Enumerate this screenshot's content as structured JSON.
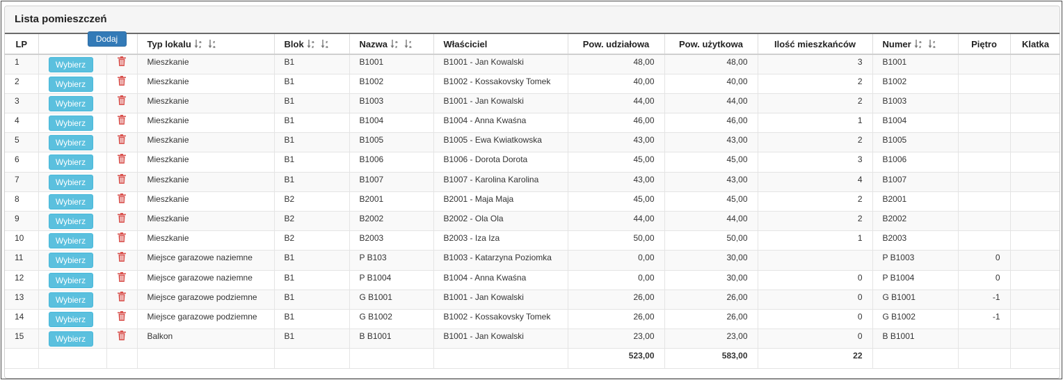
{
  "panel": {
    "title": "Lista pomieszczeń"
  },
  "header": {
    "lp": "LP",
    "dodaj": "Dodaj",
    "typ": "Typ lokalu",
    "blok": "Blok",
    "nazwa": "Nazwa",
    "wlasciciel": "Właściciel",
    "pow_udz": "Pow. udziałowa",
    "pow_uz": "Pow. użytkowa",
    "ilosc": "Ilość mieszkańców",
    "numer": "Numer",
    "pietro": "Piętro",
    "klatka": "Klatka"
  },
  "row_button_label": "Wybierz",
  "rows": [
    {
      "lp": "1",
      "typ": "Mieszkanie",
      "blok": "B1",
      "nazwa": "B1001",
      "wlasciciel": "B1001 - Jan Kowalski",
      "pow_udz": "48,00",
      "pow_uz": "48,00",
      "ilosc": "3",
      "numer": "B1001",
      "pietro": "",
      "klatka": ""
    },
    {
      "lp": "2",
      "typ": "Mieszkanie",
      "blok": "B1",
      "nazwa": "B1002",
      "wlasciciel": "B1002 - Kossakovsky Tomek",
      "pow_udz": "40,00",
      "pow_uz": "40,00",
      "ilosc": "2",
      "numer": "B1002",
      "pietro": "",
      "klatka": ""
    },
    {
      "lp": "3",
      "typ": "Mieszkanie",
      "blok": "B1",
      "nazwa": "B1003",
      "wlasciciel": "B1001 - Jan Kowalski",
      "pow_udz": "44,00",
      "pow_uz": "44,00",
      "ilosc": "2",
      "numer": "B1003",
      "pietro": "",
      "klatka": ""
    },
    {
      "lp": "4",
      "typ": "Mieszkanie",
      "blok": "B1",
      "nazwa": "B1004",
      "wlasciciel": "B1004 - Anna Kwaśna",
      "pow_udz": "46,00",
      "pow_uz": "46,00",
      "ilosc": "1",
      "numer": "B1004",
      "pietro": "",
      "klatka": ""
    },
    {
      "lp": "5",
      "typ": "Mieszkanie",
      "blok": "B1",
      "nazwa": "B1005",
      "wlasciciel": "B1005 - Ewa Kwiatkowska",
      "pow_udz": "43,00",
      "pow_uz": "43,00",
      "ilosc": "2",
      "numer": "B1005",
      "pietro": "",
      "klatka": ""
    },
    {
      "lp": "6",
      "typ": "Mieszkanie",
      "blok": "B1",
      "nazwa": "B1006",
      "wlasciciel": "B1006 - Dorota Dorota",
      "pow_udz": "45,00",
      "pow_uz": "45,00",
      "ilosc": "3",
      "numer": "B1006",
      "pietro": "",
      "klatka": ""
    },
    {
      "lp": "7",
      "typ": "Mieszkanie",
      "blok": "B1",
      "nazwa": "B1007",
      "wlasciciel": "B1007 - Karolina Karolina",
      "pow_udz": "43,00",
      "pow_uz": "43,00",
      "ilosc": "4",
      "numer": "B1007",
      "pietro": "",
      "klatka": ""
    },
    {
      "lp": "8",
      "typ": "Mieszkanie",
      "blok": "B2",
      "nazwa": "B2001",
      "wlasciciel": "B2001 - Maja Maja",
      "pow_udz": "45,00",
      "pow_uz": "45,00",
      "ilosc": "2",
      "numer": "B2001",
      "pietro": "",
      "klatka": ""
    },
    {
      "lp": "9",
      "typ": "Mieszkanie",
      "blok": "B2",
      "nazwa": "B2002",
      "wlasciciel": "B2002 - Ola Ola",
      "pow_udz": "44,00",
      "pow_uz": "44,00",
      "ilosc": "2",
      "numer": "B2002",
      "pietro": "",
      "klatka": ""
    },
    {
      "lp": "10",
      "typ": "Mieszkanie",
      "blok": "B2",
      "nazwa": "B2003",
      "wlasciciel": "B2003 - Iza Iza",
      "pow_udz": "50,00",
      "pow_uz": "50,00",
      "ilosc": "1",
      "numer": "B2003",
      "pietro": "",
      "klatka": ""
    },
    {
      "lp": "11",
      "typ": "Miejsce garazowe naziemne",
      "blok": "B1",
      "nazwa": "P B103",
      "wlasciciel": "B1003 - Katarzyna Poziomka",
      "pow_udz": "0,00",
      "pow_uz": "30,00",
      "ilosc": "",
      "numer": "P B1003",
      "pietro": "0",
      "klatka": ""
    },
    {
      "lp": "12",
      "typ": "Miejsce garazowe naziemne",
      "blok": "B1",
      "nazwa": "P B1004",
      "wlasciciel": "B1004 - Anna Kwaśna",
      "pow_udz": "0,00",
      "pow_uz": "30,00",
      "ilosc": "0",
      "numer": "P B1004",
      "pietro": "0",
      "klatka": ""
    },
    {
      "lp": "13",
      "typ": "Miejsce garazowe podziemne",
      "blok": "B1",
      "nazwa": "G B1001",
      "wlasciciel": "B1001 - Jan Kowalski",
      "pow_udz": "26,00",
      "pow_uz": "26,00",
      "ilosc": "0",
      "numer": "G B1001",
      "pietro": "-1",
      "klatka": ""
    },
    {
      "lp": "14",
      "typ": "Miejsce garazowe podziemne",
      "blok": "B1",
      "nazwa": "G B1002",
      "wlasciciel": "B1002 - Kossakovsky Tomek",
      "pow_udz": "26,00",
      "pow_uz": "26,00",
      "ilosc": "0",
      "numer": "G B1002",
      "pietro": "-1",
      "klatka": ""
    },
    {
      "lp": "15",
      "typ": "Balkon",
      "blok": "B1",
      "nazwa": "B B1001",
      "wlasciciel": "B1001 - Jan Kowalski",
      "pow_udz": "23,00",
      "pow_uz": "23,00",
      "ilosc": "0",
      "numer": "B B1001",
      "pietro": "",
      "klatka": ""
    }
  ],
  "totals": {
    "pow_udz": "523,00",
    "pow_uz": "583,00",
    "ilosc": "22"
  },
  "colors": {
    "wybierz": "#5bc0de",
    "dodaj": "#337ab7",
    "trash": "#d9534f"
  }
}
